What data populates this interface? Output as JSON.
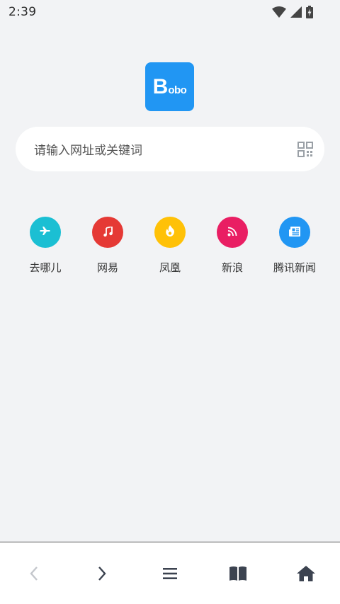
{
  "status_bar": {
    "time": "2:39",
    "icons": [
      "wifi-icon",
      "signal-icon",
      "battery-icon"
    ]
  },
  "logo": {
    "letter": "B",
    "rest": "obo",
    "color": "#2196f3"
  },
  "search": {
    "placeholder": "请输入网址或关键词",
    "scan_icon": "qr-scan-icon"
  },
  "quick_links": [
    {
      "label": "去哪儿",
      "icon": "airplane-icon",
      "color": "#1bbfd3"
    },
    {
      "label": "网易",
      "icon": "music-note-icon",
      "color": "#e53935"
    },
    {
      "label": "凤凰",
      "icon": "fire-icon",
      "color": "#ffc107"
    },
    {
      "label": "新浪",
      "icon": "rss-icon",
      "color": "#e91e63"
    },
    {
      "label": "腾讯新闻",
      "icon": "newspaper-icon",
      "color": "#2196f3"
    }
  ],
  "bottom_nav": [
    {
      "name": "back",
      "icon": "chevron-left-icon",
      "enabled": false
    },
    {
      "name": "forward",
      "icon": "chevron-right-icon",
      "enabled": true
    },
    {
      "name": "menu",
      "icon": "menu-icon",
      "enabled": true
    },
    {
      "name": "bookmarks",
      "icon": "book-icon",
      "enabled": true
    },
    {
      "name": "home",
      "icon": "home-icon",
      "enabled": true
    }
  ]
}
